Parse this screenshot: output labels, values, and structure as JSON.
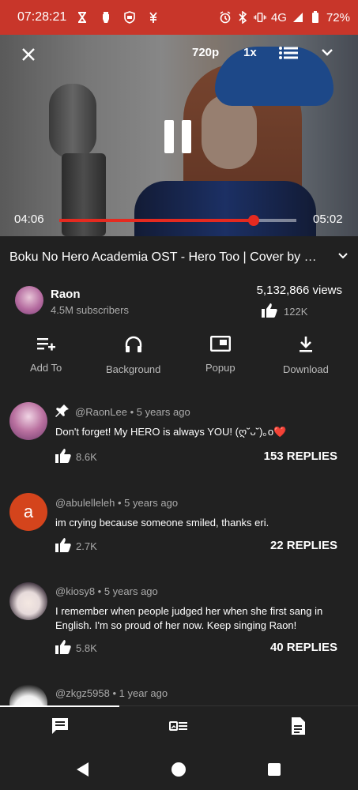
{
  "status": {
    "time": "07:28:21",
    "network": "4G",
    "battery": "72%",
    "left_icons": [
      "hourglass-icon",
      "fist-icon",
      "shield-icon",
      "money-icon"
    ],
    "right_icons": [
      "alarm-icon",
      "bluetooth-icon",
      "vibrate-icon",
      "signal-icon",
      "battery-icon"
    ]
  },
  "player": {
    "quality": "720p",
    "speed": "1x",
    "current_time": "04:06",
    "duration": "05:02",
    "progress": 0.82,
    "state": "playing"
  },
  "video": {
    "title": "Boku No Hero Academia OST - Hero Too | Cover by Raon",
    "views": "5,132,866 views",
    "likes": "122K"
  },
  "channel": {
    "name": "Raon",
    "subscribers": "4.5M subscribers"
  },
  "actions": [
    {
      "label": "Add To",
      "icon": "playlist-add-icon"
    },
    {
      "label": "Background",
      "icon": "headphones-icon"
    },
    {
      "label": "Popup",
      "icon": "popup-icon"
    },
    {
      "label": "Download",
      "icon": "download-icon"
    }
  ],
  "comments": [
    {
      "handle": "@RaonLee",
      "age": "5 years ago",
      "pinned": true,
      "text": "Don't forget! My HERO is always YOU! (ღ˘ᴗ˘)｡o❤️",
      "likes": "8.6K",
      "replies": "153 REPLIES",
      "avatar_color": "#a46a98"
    },
    {
      "handle": "@abulelleleh",
      "age": "5 years ago",
      "pinned": false,
      "text": "im crying because someone smiled, thanks eri.",
      "likes": "2.7K",
      "replies": "22 REPLIES",
      "avatar_color": "#d4441c",
      "avatar_letter": "a"
    },
    {
      "handle": "@kiosy8",
      "age": "5 years ago",
      "pinned": false,
      "text": "I remember when people judged her when she first sang in English. I'm so proud of her now. Keep singing Raon!",
      "likes": "5.8K",
      "replies": "40 REPLIES",
      "avatar_color": "#e9e4e4"
    },
    {
      "handle": "@zkgz5958",
      "age": "1 year ago",
      "pinned": false,
      "text": "",
      "likes": "",
      "replies": "",
      "avatar_color": "#f2f2f2"
    }
  ],
  "bottom_tabs": [
    {
      "name": "comments",
      "icon": "comment-icon",
      "active": true
    },
    {
      "name": "related",
      "icon": "related-items-icon",
      "active": false
    },
    {
      "name": "description",
      "icon": "description-icon",
      "active": false
    }
  ],
  "colors": {
    "status_bar": "#c8362a",
    "background": "#212121",
    "accent": "#e52a20"
  }
}
